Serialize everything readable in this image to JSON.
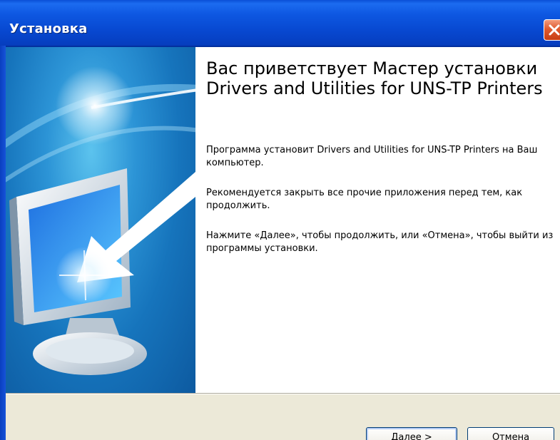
{
  "window": {
    "title": "Установка"
  },
  "welcome": {
    "heading": "Вас приветствует Мастер установки Drivers and Utilities for UNS-TP Printers",
    "paragraph1": "Программа установит Drivers and Utilities for UNS-TP Printers на Ваш компьютер.",
    "paragraph2": "Рекомендуется закрыть все прочие приложения перед тем, как продолжить.",
    "paragraph3": "Нажмите «Далее», чтобы продолжить, или «Отмена», чтобы выйти из программы установки."
  },
  "buttons": {
    "next_label": "Далее >",
    "cancel_label": "Отмена"
  },
  "icons": {
    "close": "close-icon",
    "banner": "monitor-arrow-illustration"
  },
  "colors": {
    "titlebar": "#0a4fd6",
    "close_button": "#e05a2e",
    "banner": "#1674bc",
    "button_panel": "#ece9d8"
  }
}
